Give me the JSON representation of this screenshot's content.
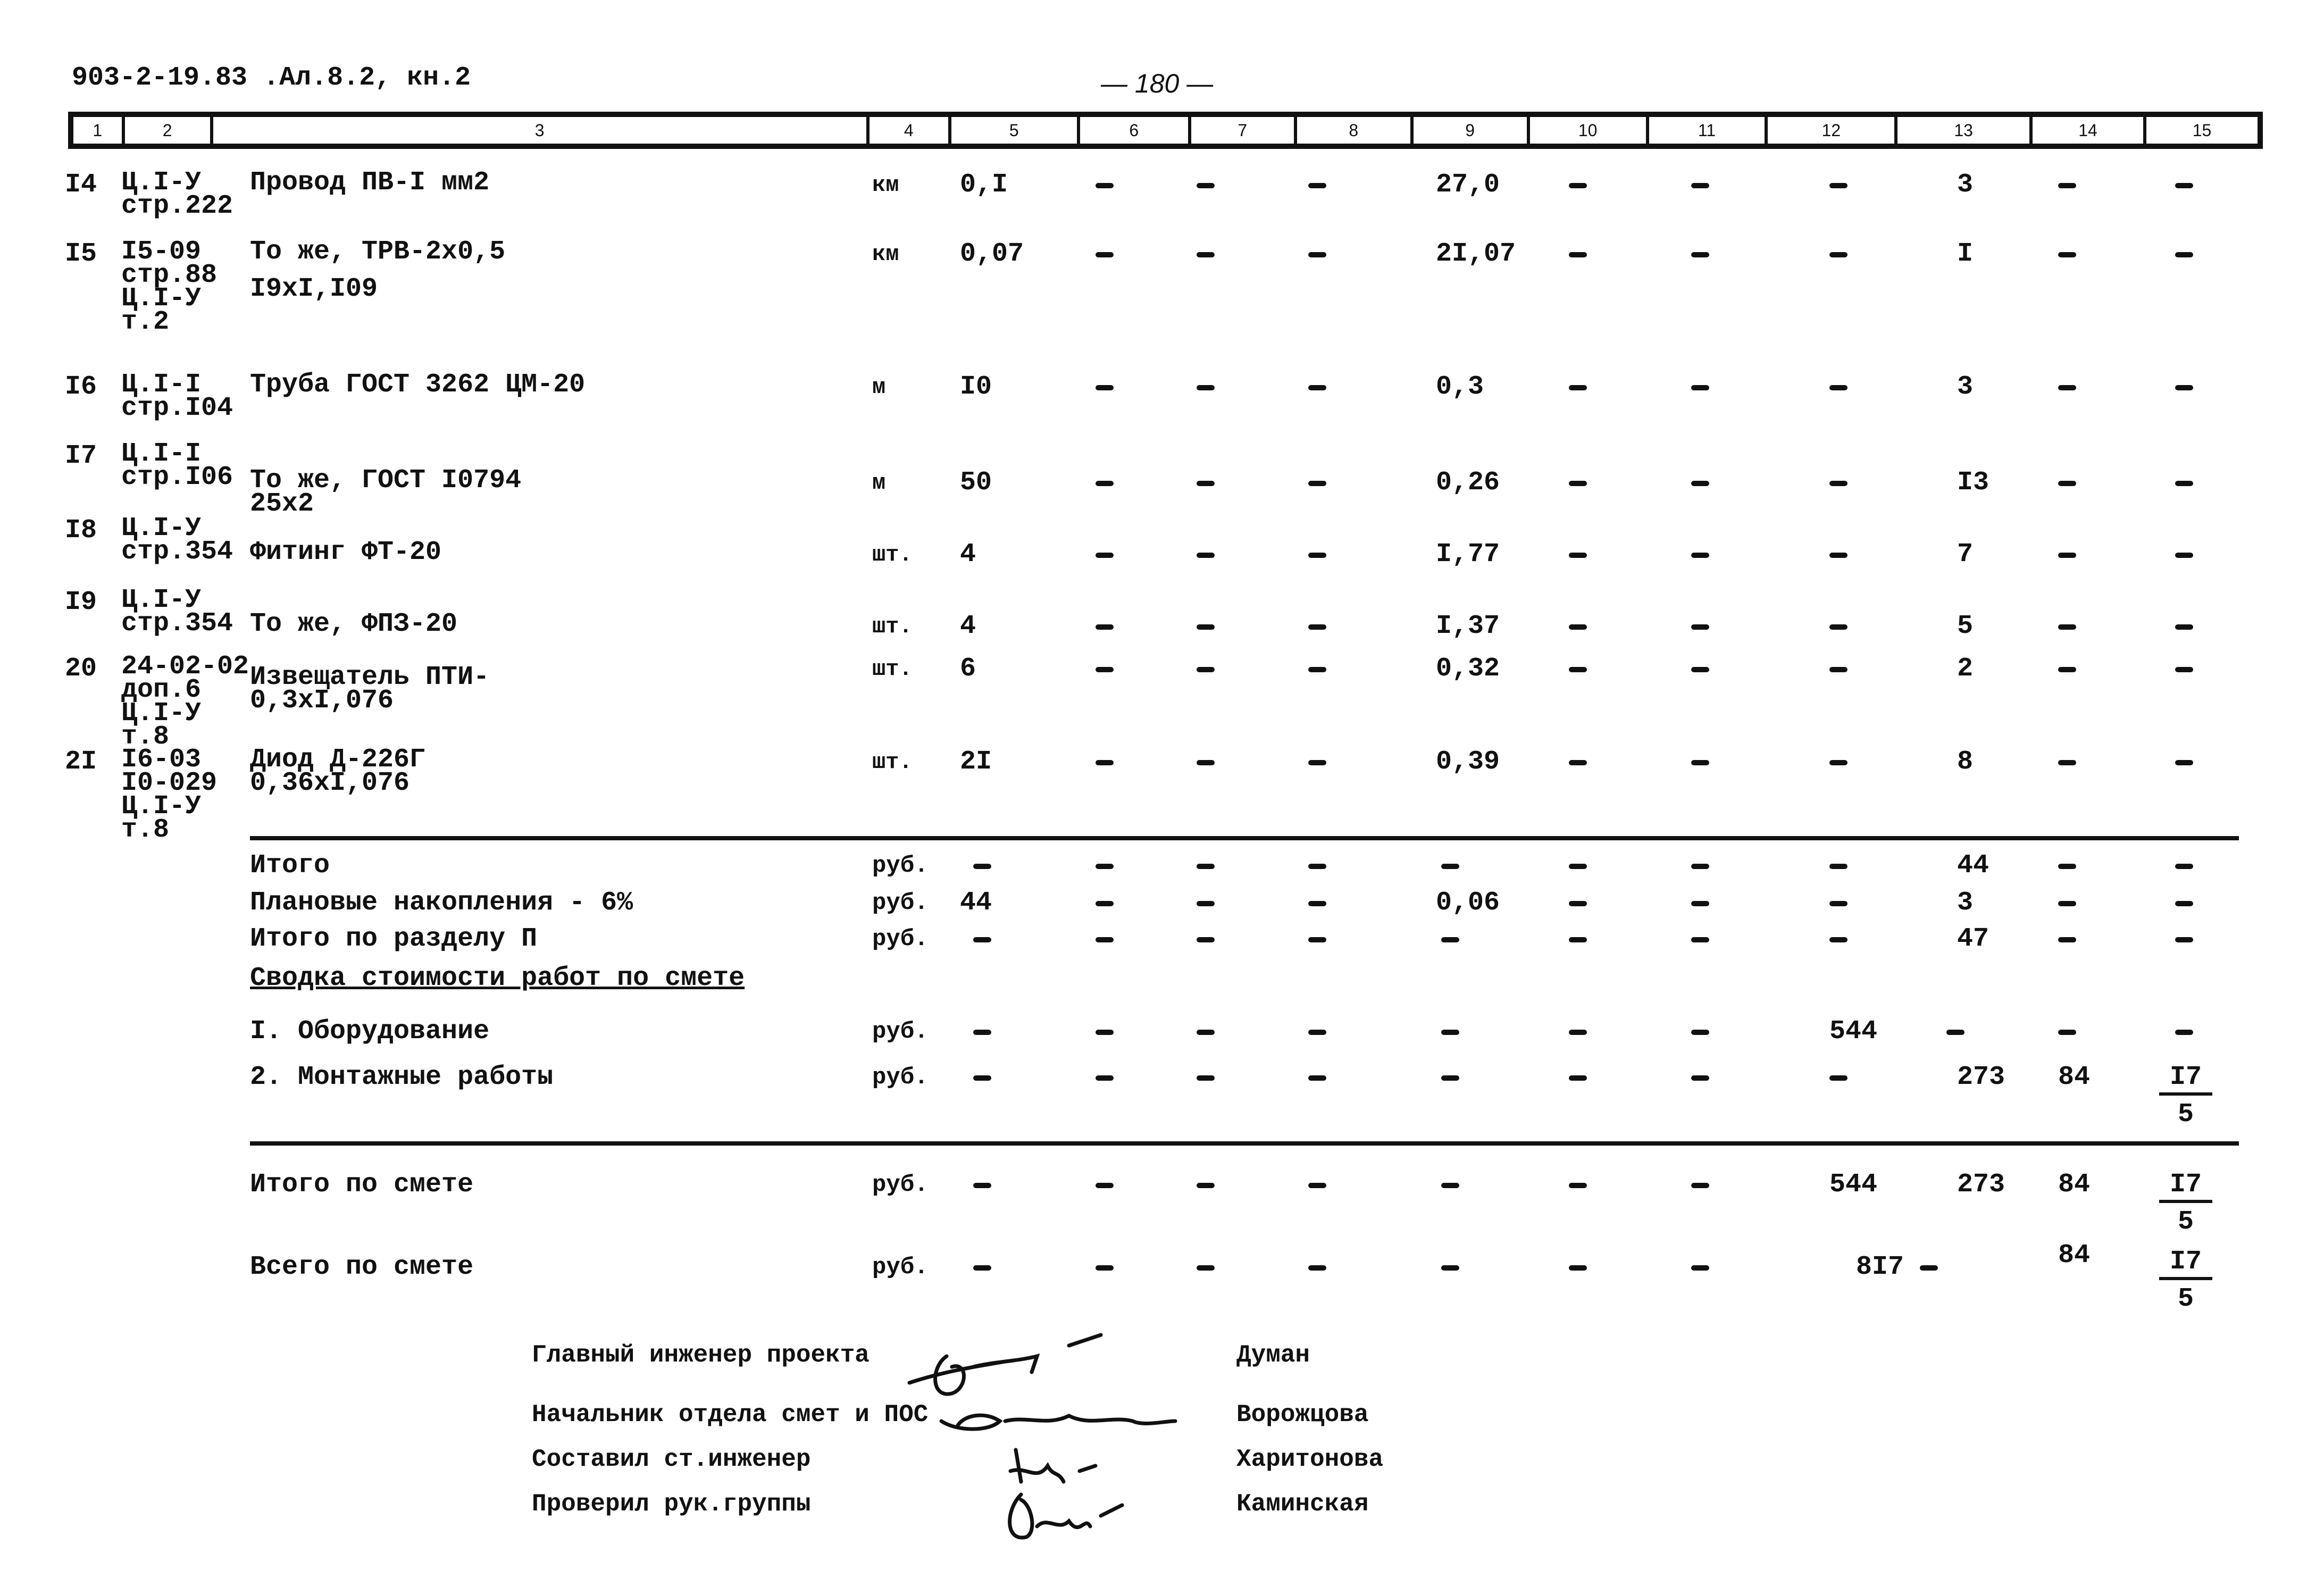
{
  "document": {
    "reference": "903-2-19.83 .Ал.8.2, кн.2",
    "page_number": "— 180 —"
  },
  "header": {
    "columns": [
      "1",
      "2",
      "3",
      "4",
      "5",
      "6",
      "7",
      "8",
      "9",
      "10",
      "11",
      "12",
      "13",
      "14",
      "15"
    ]
  },
  "rows": [
    {
      "num": "I4",
      "ref": [
        "Ц.I-У",
        "стр.222"
      ],
      "name": [
        "Провод ПВ-I мм2"
      ],
      "unit": "км",
      "c5": "0,I",
      "c6": "–",
      "c7": "–",
      "c8": "–",
      "c9": "27,0",
      "c10": "–",
      "c11": "–",
      "c12": "–",
      "c13": "3",
      "c14": "–",
      "c15": "–"
    },
    {
      "num": "I5",
      "ref": [
        "I5-09",
        "стр.88",
        "Ц.I-У",
        "т.2"
      ],
      "name": [
        "То же, ТРВ-2х0,5",
        "I9хI,I09"
      ],
      "unit": "км",
      "c5": "0,07",
      "c6": "–",
      "c7": "–",
      "c8": "–",
      "c9": "2I,07",
      "c10": "–",
      "c11": "–",
      "c12": "–",
      "c13": "I",
      "c14": "–",
      "c15": "–"
    },
    {
      "num": "I6",
      "ref": [
        "Ц.I-I",
        "стр.I04"
      ],
      "name": [
        "Труба ГОСТ 3262 ЦМ-20"
      ],
      "unit": "м",
      "c5": "I0",
      "c6": "–",
      "c7": "–",
      "c8": "–",
      "c9": "0,3",
      "c10": "–",
      "c11": "–",
      "c12": "–",
      "c13": "3",
      "c14": "–",
      "c15": "–"
    },
    {
      "num": "I7",
      "ref": [
        "Ц.I-I",
        "стр.I06"
      ],
      "name": [
        "То же, ГОСТ I0794",
        "25х2"
      ],
      "unit": "м",
      "c5": "50",
      "c6": "–",
      "c7": "–",
      "c8": "–",
      "c9": "0,26",
      "c10": "–",
      "c11": "–",
      "c12": "–",
      "c13": "I3",
      "c14": "–",
      "c15": "–"
    },
    {
      "num": "I8",
      "ref": [
        "Ц.I-У",
        "стр.354"
      ],
      "name": [
        "Фитинг ФТ-20"
      ],
      "unit": "шт.",
      "c5": "4",
      "c6": "–",
      "c7": "–",
      "c8": "–",
      "c9": "I,77",
      "c10": "–",
      "c11": "–",
      "c12": "–",
      "c13": "7",
      "c14": "–",
      "c15": "–"
    },
    {
      "num": "I9",
      "ref": [
        "Ц.I-У",
        "стр.354"
      ],
      "name": [
        "То же, ФПЗ-20"
      ],
      "unit": "шт.",
      "c5": "4",
      "c6": "–",
      "c7": "–",
      "c8": "–",
      "c9": "I,37",
      "c10": "–",
      "c11": "–",
      "c12": "–",
      "c13": "5",
      "c14": "–",
      "c15": "–"
    },
    {
      "num": "20",
      "ref": [
        "24-02-02",
        "доп.6",
        "Ц.I-У",
        "т.8"
      ],
      "name": [
        "Извещатель ПТИ-",
        "0,3хI,076"
      ],
      "unit": "шт.",
      "c5": "6",
      "c6": "–",
      "c7": "–",
      "c8": "–",
      "c9": "0,32",
      "c10": "–",
      "c11": "–",
      "c12": "–",
      "c13": "2",
      "c14": "–",
      "c15": "–"
    },
    {
      "num": "2I",
      "ref": [
        "I6-03",
        "I0-029",
        "Ц.I-У",
        "т.8"
      ],
      "name": [
        "Диод Д-226Г",
        "0,36хI,076"
      ],
      "unit": "шт.",
      "c5": "2I",
      "c6": "–",
      "c7": "–",
      "c8": "–",
      "c9": "0,39",
      "c10": "–",
      "c11": "–",
      "c12": "–",
      "c13": "8",
      "c14": "–",
      "c15": "–"
    }
  ],
  "totals": [
    {
      "label": "Итого",
      "unit": "руб.",
      "c5": "–",
      "c9": "–",
      "c12": "–",
      "c13": "44",
      "c14": "–",
      "c15": "–"
    },
    {
      "label": "Плановые накопления - 6%",
      "unit": "руб.",
      "c5": "44",
      "c9": "0,06",
      "c12": "–",
      "c13": "3",
      "c14": "–",
      "c15": "–"
    },
    {
      "label": "Итого по разделу П",
      "unit": "руб.",
      "c5": "–",
      "c9": "–",
      "c12": "–",
      "c13": "47",
      "c14": "–",
      "c15": "–"
    }
  ],
  "summary": {
    "title": "Сводка стоимости работ по смете",
    "items": [
      {
        "label": "I. Оборудование",
        "unit": "руб.",
        "c12": "544",
        "c13": "–",
        "c14": "–",
        "c15": "–"
      },
      {
        "label": "2. Монтажные работы",
        "unit": "руб.",
        "c12": "–",
        "c13": "273",
        "c14": "84",
        "c15_num": "I7",
        "c15_den": "5"
      }
    ],
    "total": {
      "label": "Итого по смете",
      "unit": "руб.",
      "c12": "544",
      "c13": "273",
      "c14": "84",
      "c15_num": "I7",
      "c15_den": "5"
    },
    "grand_total": {
      "label": "Всего по смете",
      "unit": "руб.",
      "c12": "8I7",
      "c13": "–",
      "c14": "84",
      "c15_num": "I7",
      "c15_den": "5"
    }
  },
  "signatures": [
    {
      "role": "Главный инженер проекта",
      "name": "Думан"
    },
    {
      "role": "Начальник отдела смет и ПОС",
      "name": "Ворожцова"
    },
    {
      "role": "Составил ст.инженер",
      "name": "Харитонова"
    },
    {
      "role": "Проверил рук.группы",
      "name": "Каминская"
    }
  ]
}
